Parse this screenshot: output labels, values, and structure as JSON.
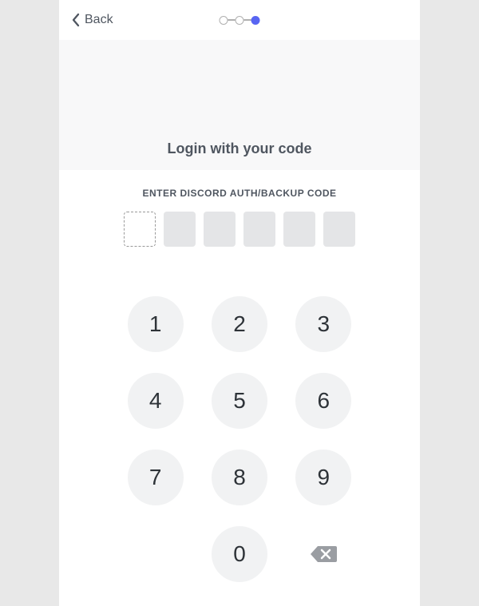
{
  "header": {
    "back_label": "Back",
    "progress": {
      "total_steps": 3,
      "current_step": 3
    }
  },
  "title": "Login with your code",
  "code_entry": {
    "label": "ENTER DISCORD AUTH/BACKUP CODE",
    "length": 6,
    "active_index": 0
  },
  "keypad": {
    "keys": [
      "1",
      "2",
      "3",
      "4",
      "5",
      "6",
      "7",
      "8",
      "9",
      "0"
    ]
  },
  "icons": {
    "back": "chevron-left-icon",
    "backspace": "backspace-icon"
  }
}
